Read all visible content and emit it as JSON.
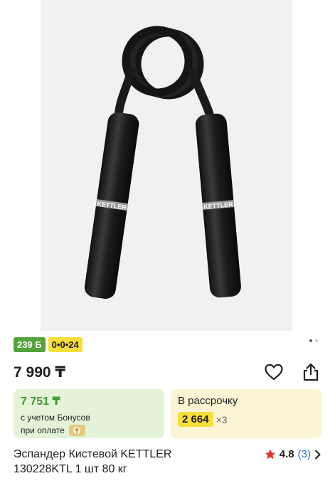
{
  "product_image": {
    "brand_mark": "KETTLER",
    "carousel": {
      "total": 2,
      "active": 1
    }
  },
  "badges": {
    "bonus": "239 Б",
    "installment": "0•0•24"
  },
  "price": "7 990 ₸",
  "actions": {
    "favorite_icon": "heart-icon",
    "share_icon": "share-icon"
  },
  "bonus_card": {
    "price": "7 751 ₸",
    "note": "с учетом Бонусов",
    "pay_label": "при оплате",
    "pay_icon": "card-chip-icon"
  },
  "installment_card": {
    "title": "В рассрочку",
    "amount": "2 664",
    "times": "×3"
  },
  "product": {
    "title": "Эспандер Кистевой KETTLER 130228KTL 1 шт 80 кг",
    "rating": "4.8",
    "reviews": "(3)"
  },
  "colors": {
    "bonus_green": "#53a23a",
    "installment_yellow": "#f6de3b",
    "star_red": "#e0332e",
    "link_blue": "#2e69b7"
  }
}
